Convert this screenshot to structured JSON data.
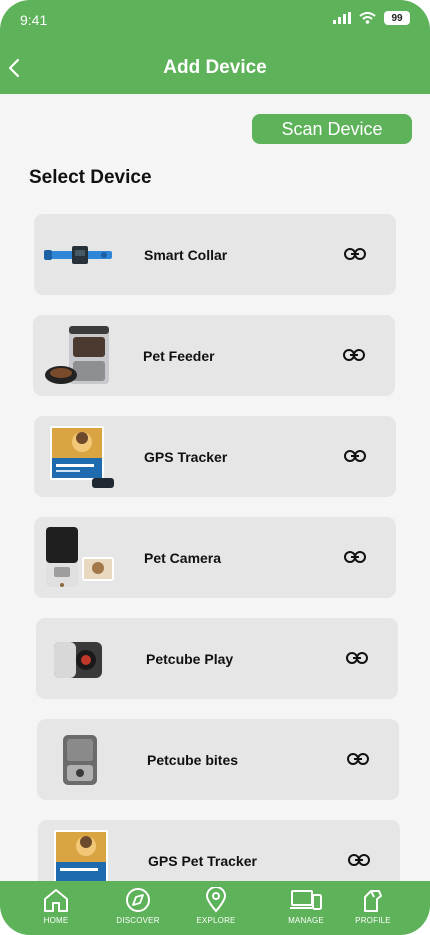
{
  "status_bar": {
    "time": "9:41",
    "battery": "99"
  },
  "header": {
    "title": "Add Device"
  },
  "scan_button": {
    "label": "Scan Device"
  },
  "section": {
    "title": "Select Device"
  },
  "devices": [
    {
      "label": "Smart Collar"
    },
    {
      "label": "Pet Feeder"
    },
    {
      "label": "GPS Tracker"
    },
    {
      "label": "Pet Camera"
    },
    {
      "label": "Petcube Play"
    },
    {
      "label": "Petcube bites"
    },
    {
      "label": "GPS Pet Tracker"
    }
  ],
  "nav": [
    {
      "label": "HOME",
      "icon": "home-icon"
    },
    {
      "label": "DISCOVER",
      "icon": "compass-icon"
    },
    {
      "label": "EXPLORE",
      "icon": "location-pin-icon"
    },
    {
      "label": "MANAGE",
      "icon": "devices-icon"
    },
    {
      "label": "PROFILE",
      "icon": "profile-icon"
    }
  ],
  "colors": {
    "brand_green": "#5db25a",
    "card": "#e6e6e6",
    "background": "#f5f5f5"
  }
}
